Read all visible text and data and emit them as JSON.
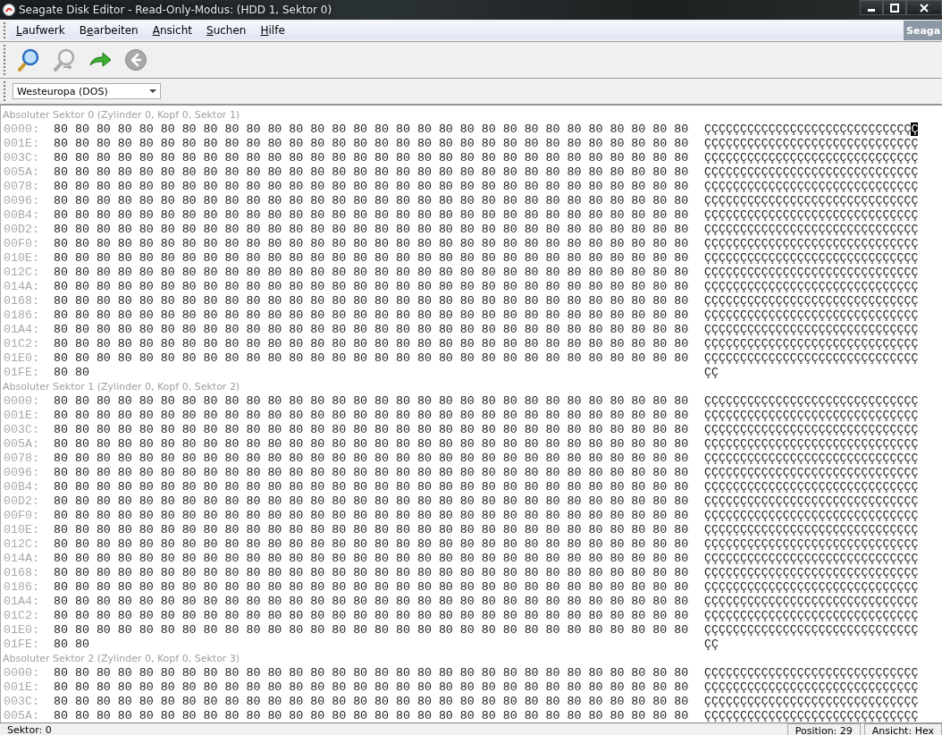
{
  "window": {
    "title": "Seagate Disk Editor - Read-Only-Modus: (HDD 1, Sektor 0)"
  },
  "menu": [
    {
      "key": "L",
      "post": "aufwerk"
    },
    {
      "pre": "B",
      "key": "e",
      "post": "arbeiten"
    },
    {
      "key": "A",
      "post": "nsicht"
    },
    {
      "key": "S",
      "post": "uchen"
    },
    {
      "key": "H",
      "post": "ilfe"
    }
  ],
  "menu_bar_caption": "Seaga",
  "toolbar": [
    {
      "kind": "find",
      "disabled": false
    },
    {
      "kind": "find-next",
      "disabled": true
    },
    {
      "kind": "go",
      "disabled": false
    },
    {
      "kind": "back",
      "disabled": true
    }
  ],
  "encoding": {
    "value": "Westeuropa (DOS)"
  },
  "sectors": [
    {
      "header": "Absoluter Sektor 0 (Zylinder 0, Kopf 0, Sektor 1)",
      "rows": [
        {
          "offset": "0000:",
          "hex": "80 80 80 80 80 80 80 80 80 80 80 80 80 80 80 80 80 80 80 80 80 80 80 80 80 80 80 80 80 80",
          "ascii": "ÇÇÇÇÇÇÇÇÇÇÇÇÇÇÇÇÇÇÇÇÇÇÇÇÇÇÇÇÇ",
          "cursor": "Ç"
        },
        {
          "offset": "001E:",
          "hex": "80 80 80 80 80 80 80 80 80 80 80 80 80 80 80 80 80 80 80 80 80 80 80 80 80 80 80 80 80 80",
          "ascii": "ÇÇÇÇÇÇÇÇÇÇÇÇÇÇÇÇÇÇÇÇÇÇÇÇÇÇÇÇÇÇ"
        },
        {
          "offset": "003C:",
          "hex": "80 80 80 80 80 80 80 80 80 80 80 80 80 80 80 80 80 80 80 80 80 80 80 80 80 80 80 80 80 80",
          "ascii": "ÇÇÇÇÇÇÇÇÇÇÇÇÇÇÇÇÇÇÇÇÇÇÇÇÇÇÇÇÇÇ"
        },
        {
          "offset": "005A:",
          "hex": "80 80 80 80 80 80 80 80 80 80 80 80 80 80 80 80 80 80 80 80 80 80 80 80 80 80 80 80 80 80",
          "ascii": "ÇÇÇÇÇÇÇÇÇÇÇÇÇÇÇÇÇÇÇÇÇÇÇÇÇÇÇÇÇÇ"
        },
        {
          "offset": "0078:",
          "hex": "80 80 80 80 80 80 80 80 80 80 80 80 80 80 80 80 80 80 80 80 80 80 80 80 80 80 80 80 80 80",
          "ascii": "ÇÇÇÇÇÇÇÇÇÇÇÇÇÇÇÇÇÇÇÇÇÇÇÇÇÇÇÇÇÇ"
        },
        {
          "offset": "0096:",
          "hex": "80 80 80 80 80 80 80 80 80 80 80 80 80 80 80 80 80 80 80 80 80 80 80 80 80 80 80 80 80 80",
          "ascii": "ÇÇÇÇÇÇÇÇÇÇÇÇÇÇÇÇÇÇÇÇÇÇÇÇÇÇÇÇÇÇ"
        },
        {
          "offset": "00B4:",
          "hex": "80 80 80 80 80 80 80 80 80 80 80 80 80 80 80 80 80 80 80 80 80 80 80 80 80 80 80 80 80 80",
          "ascii": "ÇÇÇÇÇÇÇÇÇÇÇÇÇÇÇÇÇÇÇÇÇÇÇÇÇÇÇÇÇÇ"
        },
        {
          "offset": "00D2:",
          "hex": "80 80 80 80 80 80 80 80 80 80 80 80 80 80 80 80 80 80 80 80 80 80 80 80 80 80 80 80 80 80",
          "ascii": "ÇÇÇÇÇÇÇÇÇÇÇÇÇÇÇÇÇÇÇÇÇÇÇÇÇÇÇÇÇÇ"
        },
        {
          "offset": "00F0:",
          "hex": "80 80 80 80 80 80 80 80 80 80 80 80 80 80 80 80 80 80 80 80 80 80 80 80 80 80 80 80 80 80",
          "ascii": "ÇÇÇÇÇÇÇÇÇÇÇÇÇÇÇÇÇÇÇÇÇÇÇÇÇÇÇÇÇÇ"
        },
        {
          "offset": "010E:",
          "hex": "80 80 80 80 80 80 80 80 80 80 80 80 80 80 80 80 80 80 80 80 80 80 80 80 80 80 80 80 80 80",
          "ascii": "ÇÇÇÇÇÇÇÇÇÇÇÇÇÇÇÇÇÇÇÇÇÇÇÇÇÇÇÇÇÇ"
        },
        {
          "offset": "012C:",
          "hex": "80 80 80 80 80 80 80 80 80 80 80 80 80 80 80 80 80 80 80 80 80 80 80 80 80 80 80 80 80 80",
          "ascii": "ÇÇÇÇÇÇÇÇÇÇÇÇÇÇÇÇÇÇÇÇÇÇÇÇÇÇÇÇÇÇ"
        },
        {
          "offset": "014A:",
          "hex": "80 80 80 80 80 80 80 80 80 80 80 80 80 80 80 80 80 80 80 80 80 80 80 80 80 80 80 80 80 80",
          "ascii": "ÇÇÇÇÇÇÇÇÇÇÇÇÇÇÇÇÇÇÇÇÇÇÇÇÇÇÇÇÇÇ"
        },
        {
          "offset": "0168:",
          "hex": "80 80 80 80 80 80 80 80 80 80 80 80 80 80 80 80 80 80 80 80 80 80 80 80 80 80 80 80 80 80",
          "ascii": "ÇÇÇÇÇÇÇÇÇÇÇÇÇÇÇÇÇÇÇÇÇÇÇÇÇÇÇÇÇÇ"
        },
        {
          "offset": "0186:",
          "hex": "80 80 80 80 80 80 80 80 80 80 80 80 80 80 80 80 80 80 80 80 80 80 80 80 80 80 80 80 80 80",
          "ascii": "ÇÇÇÇÇÇÇÇÇÇÇÇÇÇÇÇÇÇÇÇÇÇÇÇÇÇÇÇÇÇ"
        },
        {
          "offset": "01A4:",
          "hex": "80 80 80 80 80 80 80 80 80 80 80 80 80 80 80 80 80 80 80 80 80 80 80 80 80 80 80 80 80 80",
          "ascii": "ÇÇÇÇÇÇÇÇÇÇÇÇÇÇÇÇÇÇÇÇÇÇÇÇÇÇÇÇÇÇ"
        },
        {
          "offset": "01C2:",
          "hex": "80 80 80 80 80 80 80 80 80 80 80 80 80 80 80 80 80 80 80 80 80 80 80 80 80 80 80 80 80 80",
          "ascii": "ÇÇÇÇÇÇÇÇÇÇÇÇÇÇÇÇÇÇÇÇÇÇÇÇÇÇÇÇÇÇ"
        },
        {
          "offset": "01E0:",
          "hex": "80 80 80 80 80 80 80 80 80 80 80 80 80 80 80 80 80 80 80 80 80 80 80 80 80 80 80 80 80 80",
          "ascii": "ÇÇÇÇÇÇÇÇÇÇÇÇÇÇÇÇÇÇÇÇÇÇÇÇÇÇÇÇÇÇ"
        },
        {
          "offset": "01FE:",
          "hex": "80 80",
          "ascii": "ÇÇ"
        }
      ]
    },
    {
      "header": "Absoluter Sektor 1 (Zylinder 0, Kopf 0, Sektor 2)",
      "rows": [
        {
          "offset": "0000:",
          "hex": "80 80 80 80 80 80 80 80 80 80 80 80 80 80 80 80 80 80 80 80 80 80 80 80 80 80 80 80 80 80",
          "ascii": "ÇÇÇÇÇÇÇÇÇÇÇÇÇÇÇÇÇÇÇÇÇÇÇÇÇÇÇÇÇÇ"
        },
        {
          "offset": "001E:",
          "hex": "80 80 80 80 80 80 80 80 80 80 80 80 80 80 80 80 80 80 80 80 80 80 80 80 80 80 80 80 80 80",
          "ascii": "ÇÇÇÇÇÇÇÇÇÇÇÇÇÇÇÇÇÇÇÇÇÇÇÇÇÇÇÇÇÇ"
        },
        {
          "offset": "003C:",
          "hex": "80 80 80 80 80 80 80 80 80 80 80 80 80 80 80 80 80 80 80 80 80 80 80 80 80 80 80 80 80 80",
          "ascii": "ÇÇÇÇÇÇÇÇÇÇÇÇÇÇÇÇÇÇÇÇÇÇÇÇÇÇÇÇÇÇ"
        },
        {
          "offset": "005A:",
          "hex": "80 80 80 80 80 80 80 80 80 80 80 80 80 80 80 80 80 80 80 80 80 80 80 80 80 80 80 80 80 80",
          "ascii": "ÇÇÇÇÇÇÇÇÇÇÇÇÇÇÇÇÇÇÇÇÇÇÇÇÇÇÇÇÇÇ"
        },
        {
          "offset": "0078:",
          "hex": "80 80 80 80 80 80 80 80 80 80 80 80 80 80 80 80 80 80 80 80 80 80 80 80 80 80 80 80 80 80",
          "ascii": "ÇÇÇÇÇÇÇÇÇÇÇÇÇÇÇÇÇÇÇÇÇÇÇÇÇÇÇÇÇÇ"
        },
        {
          "offset": "0096:",
          "hex": "80 80 80 80 80 80 80 80 80 80 80 80 80 80 80 80 80 80 80 80 80 80 80 80 80 80 80 80 80 80",
          "ascii": "ÇÇÇÇÇÇÇÇÇÇÇÇÇÇÇÇÇÇÇÇÇÇÇÇÇÇÇÇÇÇ"
        },
        {
          "offset": "00B4:",
          "hex": "80 80 80 80 80 80 80 80 80 80 80 80 80 80 80 80 80 80 80 80 80 80 80 80 80 80 80 80 80 80",
          "ascii": "ÇÇÇÇÇÇÇÇÇÇÇÇÇÇÇÇÇÇÇÇÇÇÇÇÇÇÇÇÇÇ"
        },
        {
          "offset": "00D2:",
          "hex": "80 80 80 80 80 80 80 80 80 80 80 80 80 80 80 80 80 80 80 80 80 80 80 80 80 80 80 80 80 80",
          "ascii": "ÇÇÇÇÇÇÇÇÇÇÇÇÇÇÇÇÇÇÇÇÇÇÇÇÇÇÇÇÇÇ"
        },
        {
          "offset": "00F0:",
          "hex": "80 80 80 80 80 80 80 80 80 80 80 80 80 80 80 80 80 80 80 80 80 80 80 80 80 80 80 80 80 80",
          "ascii": "ÇÇÇÇÇÇÇÇÇÇÇÇÇÇÇÇÇÇÇÇÇÇÇÇÇÇÇÇÇÇ"
        },
        {
          "offset": "010E:",
          "hex": "80 80 80 80 80 80 80 80 80 80 80 80 80 80 80 80 80 80 80 80 80 80 80 80 80 80 80 80 80 80",
          "ascii": "ÇÇÇÇÇÇÇÇÇÇÇÇÇÇÇÇÇÇÇÇÇÇÇÇÇÇÇÇÇÇ"
        },
        {
          "offset": "012C:",
          "hex": "80 80 80 80 80 80 80 80 80 80 80 80 80 80 80 80 80 80 80 80 80 80 80 80 80 80 80 80 80 80",
          "ascii": "ÇÇÇÇÇÇÇÇÇÇÇÇÇÇÇÇÇÇÇÇÇÇÇÇÇÇÇÇÇÇ"
        },
        {
          "offset": "014A:",
          "hex": "80 80 80 80 80 80 80 80 80 80 80 80 80 80 80 80 80 80 80 80 80 80 80 80 80 80 80 80 80 80",
          "ascii": "ÇÇÇÇÇÇÇÇÇÇÇÇÇÇÇÇÇÇÇÇÇÇÇÇÇÇÇÇÇÇ"
        },
        {
          "offset": "0168:",
          "hex": "80 80 80 80 80 80 80 80 80 80 80 80 80 80 80 80 80 80 80 80 80 80 80 80 80 80 80 80 80 80",
          "ascii": "ÇÇÇÇÇÇÇÇÇÇÇÇÇÇÇÇÇÇÇÇÇÇÇÇÇÇÇÇÇÇ"
        },
        {
          "offset": "0186:",
          "hex": "80 80 80 80 80 80 80 80 80 80 80 80 80 80 80 80 80 80 80 80 80 80 80 80 80 80 80 80 80 80",
          "ascii": "ÇÇÇÇÇÇÇÇÇÇÇÇÇÇÇÇÇÇÇÇÇÇÇÇÇÇÇÇÇÇ"
        },
        {
          "offset": "01A4:",
          "hex": "80 80 80 80 80 80 80 80 80 80 80 80 80 80 80 80 80 80 80 80 80 80 80 80 80 80 80 80 80 80",
          "ascii": "ÇÇÇÇÇÇÇÇÇÇÇÇÇÇÇÇÇÇÇÇÇÇÇÇÇÇÇÇÇÇ"
        },
        {
          "offset": "01C2:",
          "hex": "80 80 80 80 80 80 80 80 80 80 80 80 80 80 80 80 80 80 80 80 80 80 80 80 80 80 80 80 80 80",
          "ascii": "ÇÇÇÇÇÇÇÇÇÇÇÇÇÇÇÇÇÇÇÇÇÇÇÇÇÇÇÇÇÇ"
        },
        {
          "offset": "01E0:",
          "hex": "80 80 80 80 80 80 80 80 80 80 80 80 80 80 80 80 80 80 80 80 80 80 80 80 80 80 80 80 80 80",
          "ascii": "ÇÇÇÇÇÇÇÇÇÇÇÇÇÇÇÇÇÇÇÇÇÇÇÇÇÇÇÇÇÇ"
        },
        {
          "offset": "01FE:",
          "hex": "80 80",
          "ascii": "ÇÇ"
        }
      ]
    },
    {
      "header": "Absoluter Sektor 2 (Zylinder 0, Kopf 0, Sektor 3)",
      "rows": [
        {
          "offset": "0000:",
          "hex": "80 80 80 80 80 80 80 80 80 80 80 80 80 80 80 80 80 80 80 80 80 80 80 80 80 80 80 80 80 80",
          "ascii": "ÇÇÇÇÇÇÇÇÇÇÇÇÇÇÇÇÇÇÇÇÇÇÇÇÇÇÇÇÇÇ"
        },
        {
          "offset": "001E:",
          "hex": "80 80 80 80 80 80 80 80 80 80 80 80 80 80 80 80 80 80 80 80 80 80 80 80 80 80 80 80 80 80",
          "ascii": "ÇÇÇÇÇÇÇÇÇÇÇÇÇÇÇÇÇÇÇÇÇÇÇÇÇÇÇÇÇÇ"
        },
        {
          "offset": "003C:",
          "hex": "80 80 80 80 80 80 80 80 80 80 80 80 80 80 80 80 80 80 80 80 80 80 80 80 80 80 80 80 80 80",
          "ascii": "ÇÇÇÇÇÇÇÇÇÇÇÇÇÇÇÇÇÇÇÇÇÇÇÇÇÇÇÇÇÇ"
        },
        {
          "offset": "005A:",
          "hex": "80 80 80 80 80 80 80 80 80 80 80 80 80 80 80 80 80 80 80 80 80 80 80 80 80 80 80 80 80 80",
          "ascii": "ÇÇÇÇÇÇÇÇÇÇÇÇÇÇÇÇÇÇÇÇÇÇÇÇÇÇÇÇÇÇ"
        }
      ]
    }
  ],
  "status_bar": {
    "sector": "Sektor: 0",
    "position": "Position: 29",
    "view": "Ansicht: Hex"
  }
}
